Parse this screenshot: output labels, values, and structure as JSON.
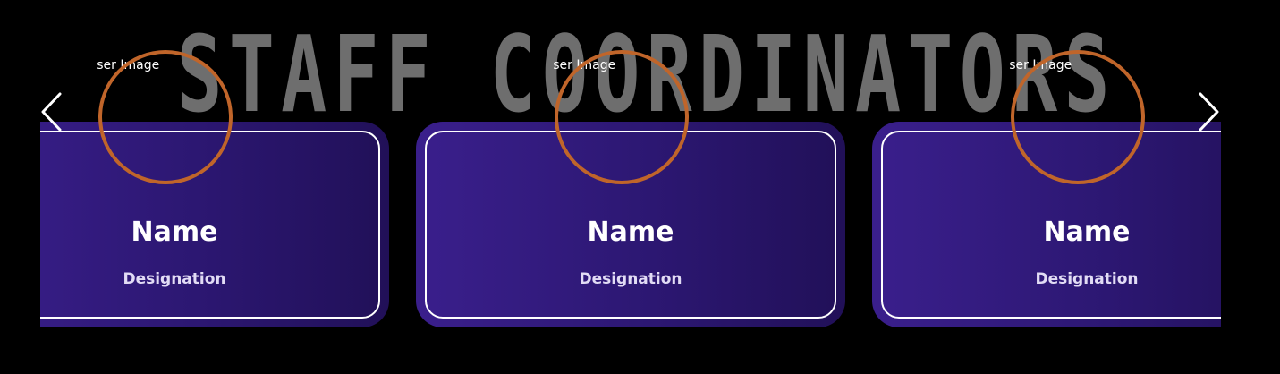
{
  "section": {
    "title": "STAFF COORDINATORS"
  },
  "colors": {
    "background": "#000000",
    "title_color": "#6e6e6e",
    "card_gradient_start": "#3a1f8c",
    "card_gradient_end": "#211058",
    "card_border": "#ffffff",
    "avatar_ring": "#c0652a"
  },
  "carousel": {
    "prev_icon": "chevron-left-icon",
    "next_icon": "chevron-right-icon",
    "cards": [
      {
        "image_alt": "User Image",
        "name": "Name",
        "designation": "Designation"
      },
      {
        "image_alt": "User Image",
        "name": "Name",
        "designation": "Designation"
      },
      {
        "image_alt": "User Image",
        "name": "Name",
        "designation": "Designation"
      }
    ]
  }
}
